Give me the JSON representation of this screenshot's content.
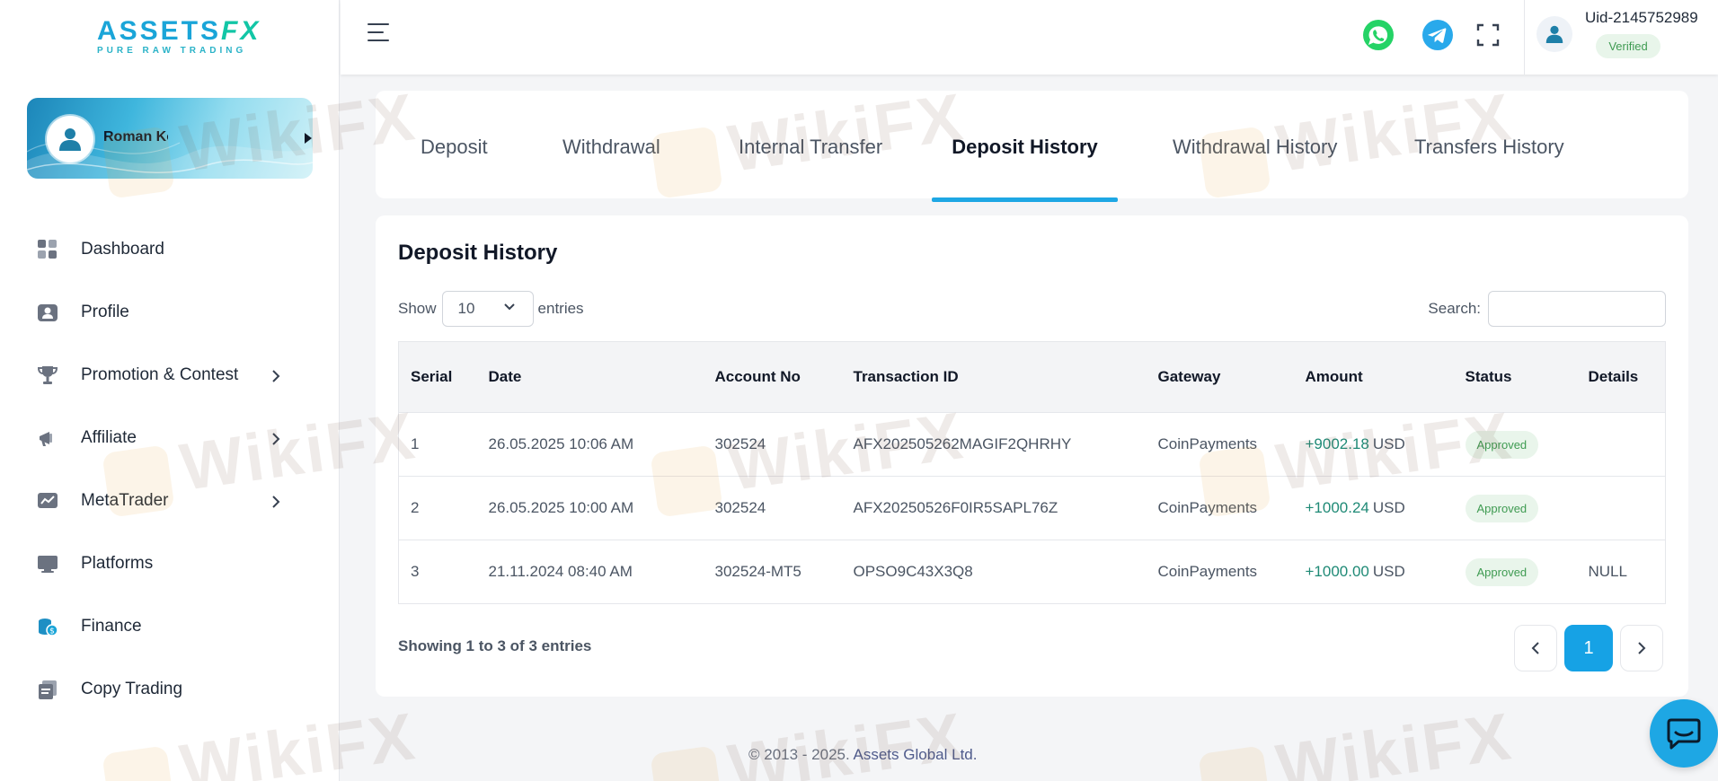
{
  "brand": {
    "logo_main_a": "ASSETS",
    "logo_main_fx": "FX",
    "logo_sub": "PURE RAW TRADING"
  },
  "user": {
    "name": "Roman Ko",
    "uid": "Uid-2145752989",
    "status": "Verified"
  },
  "sidebar": {
    "items": [
      {
        "label": "Dashboard",
        "icon": "dashboard-icon",
        "has_submenu": false
      },
      {
        "label": "Profile",
        "icon": "profile-icon",
        "has_submenu": false
      },
      {
        "label": "Promotion & Contest",
        "icon": "trophy-icon",
        "has_submenu": true
      },
      {
        "label": "Affiliate",
        "icon": "megaphone-icon",
        "has_submenu": true
      },
      {
        "label": "MetaTrader",
        "icon": "chart-monitor-icon",
        "has_submenu": true
      },
      {
        "label": "Platforms",
        "icon": "monitor-icon",
        "has_submenu": false
      },
      {
        "label": "Finance",
        "icon": "coins-icon",
        "has_submenu": false
      },
      {
        "label": "Copy Trading",
        "icon": "copy-icon",
        "has_submenu": false
      }
    ]
  },
  "tabs": [
    {
      "label": "Deposit",
      "active": false
    },
    {
      "label": "Withdrawal",
      "active": false
    },
    {
      "label": "Internal Transfer",
      "active": false
    },
    {
      "label": "Deposit History",
      "active": true
    },
    {
      "label": "Withdrawal History",
      "active": false
    },
    {
      "label": "Transfers History",
      "active": false
    }
  ],
  "history": {
    "title": "Deposit History",
    "show_label": "Show",
    "entries_value": "10",
    "entries_label": "entries",
    "search_label": "Search:",
    "search_value": "",
    "columns": [
      "Serial",
      "Date",
      "Account No",
      "Transaction ID",
      "Gateway",
      "Amount",
      "Status",
      "Details"
    ],
    "rows": [
      {
        "serial": "1",
        "date": "26.05.2025 10:06 AM",
        "account": "302524",
        "txid": "AFX202505262MAGIF2QHRHY",
        "gateway": "CoinPayments",
        "amount": "+9002.18",
        "currency": "USD",
        "status": "Approved",
        "details": ""
      },
      {
        "serial": "2",
        "date": "26.05.2025 10:00 AM",
        "account": "302524",
        "txid": "AFX20250526F0IR5SAPL76Z",
        "gateway": "CoinPayments",
        "amount": "+1000.24",
        "currency": "USD",
        "status": "Approved",
        "details": ""
      },
      {
        "serial": "3",
        "date": "21.11.2024 08:40 AM",
        "account": "302524-MT5",
        "txid": "OPSO9C43X3Q8",
        "gateway": "CoinPayments",
        "amount": "+1000.00",
        "currency": "USD",
        "status": "Approved",
        "details": "NULL"
      }
    ],
    "showing_text": "Showing 1 to 3 of 3 entries",
    "current_page": "1"
  },
  "footer": {
    "copyright": "© 2013 - 2025.",
    "company": "Assets Global Ltd."
  },
  "watermark": "WikiFX",
  "colors": {
    "accent": "#1ea7e4",
    "approved_bg": "#e9f5eb",
    "approved_text": "#3f9b52",
    "amount": "#1f8a76"
  }
}
